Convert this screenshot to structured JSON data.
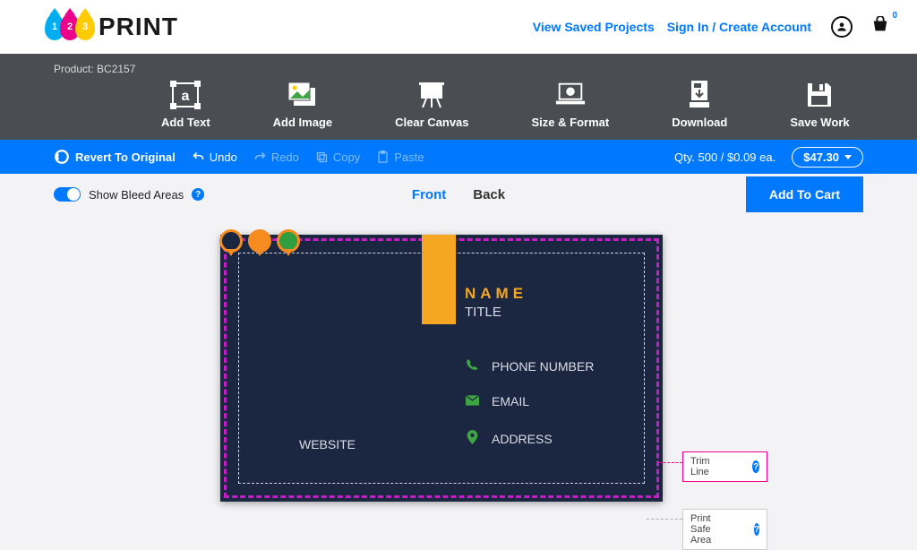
{
  "header": {
    "logo_text": "PRINT",
    "drops": [
      "1",
      "2",
      "3"
    ],
    "links": {
      "saved_projects": "View Saved Projects",
      "sign_in": "Sign In / Create Account"
    },
    "cart_count": "0"
  },
  "toolbar": {
    "product_label": "Product: BC2157",
    "actions": {
      "add_text": "Add Text",
      "add_image": "Add Image",
      "clear_canvas": "Clear Canvas",
      "size_format": "Size & Format",
      "download": "Download",
      "save_work": "Save Work"
    }
  },
  "bluebar": {
    "revert": "Revert To Original",
    "undo": "Undo",
    "redo": "Redo",
    "copy": "Copy",
    "paste": "Paste",
    "qty_price": "Qty. 500 / $0.09 ea.",
    "total_price": "$47.30"
  },
  "subbar": {
    "bleed_toggle_label": "Show Bleed Areas",
    "tabs": {
      "front": "Front",
      "back": "Back"
    },
    "add_to_cart": "Add To Cart"
  },
  "guides": {
    "trim": "Trim Line",
    "safe": "Print Safe Area"
  },
  "card": {
    "name": "NAME",
    "title": "TITLE",
    "phone": "PHONE NUMBER",
    "email": "EMAIL",
    "address": "ADDRESS",
    "website": "WEBSITE"
  },
  "colors": {
    "accent": "#0079ff",
    "orange": "#f5a623",
    "card_bg": "#1b2641",
    "bleed": "#c51ec5"
  }
}
